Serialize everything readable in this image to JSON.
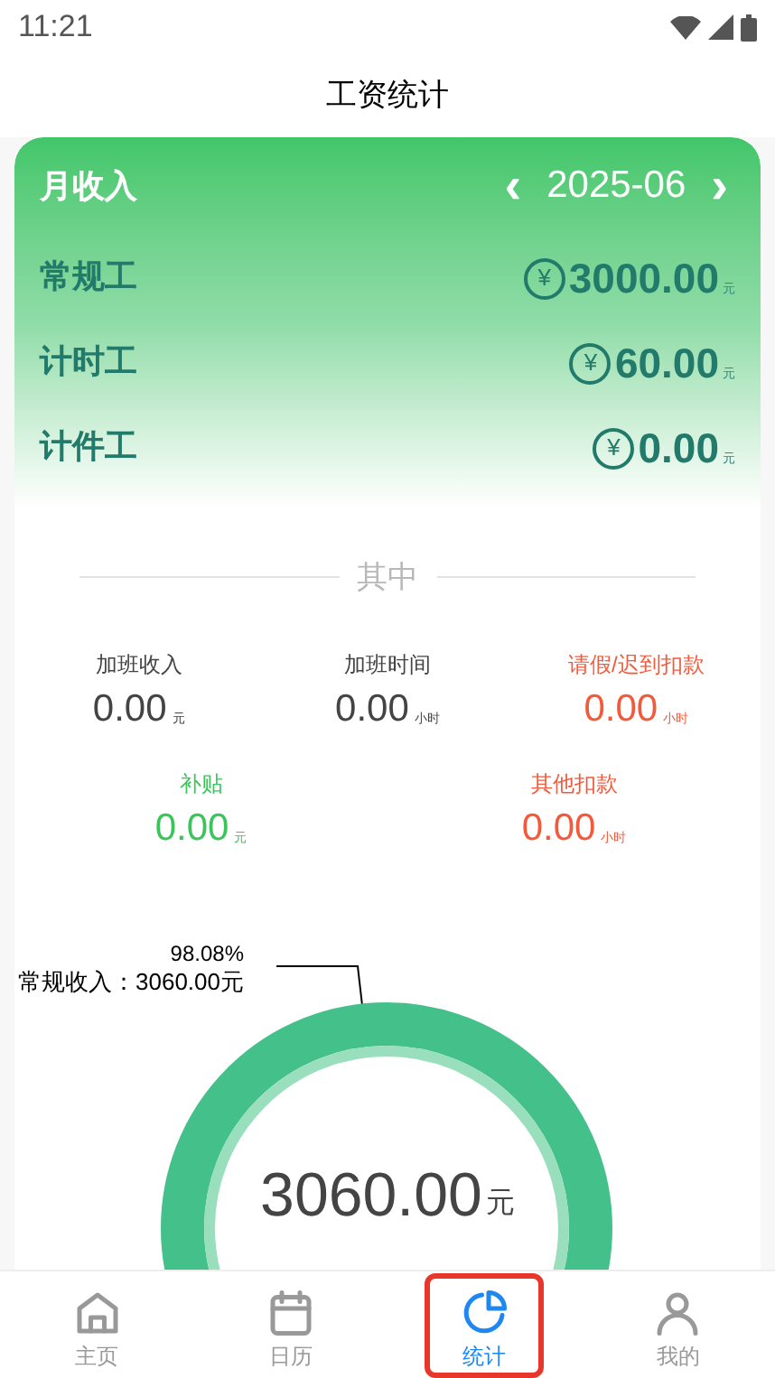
{
  "status_bar": {
    "time": "11:21"
  },
  "title": "工资统计",
  "income_card": {
    "title": "月收入",
    "prev": "‹",
    "month": "2025-06",
    "next": "›",
    "rows": [
      {
        "label": "常规工",
        "currency": "¥",
        "amount": "3000.00",
        "unit": "元"
      },
      {
        "label": "计时工",
        "currency": "¥",
        "amount": "60.00",
        "unit": "元"
      },
      {
        "label": "计件工",
        "currency": "¥",
        "amount": "0.00",
        "unit": "元"
      }
    ]
  },
  "breakdown": {
    "heading": "其中",
    "stats": [
      [
        {
          "label": "加班收入",
          "value": "0.00",
          "unit": "元",
          "color": "#444444"
        },
        {
          "label": "加班时间",
          "value": "0.00",
          "unit": "小时",
          "color": "#444444"
        },
        {
          "label": "请假/迟到扣款",
          "value": "0.00",
          "unit": "小时",
          "color": "#f25a3c"
        }
      ],
      [
        {
          "label": "补贴",
          "value": "0.00",
          "unit": "元",
          "color": "#3cc45c"
        },
        {
          "label": "其他扣款",
          "value": "0.00",
          "unit": "小时",
          "color": "#f25a3c"
        }
      ]
    ]
  },
  "donut": {
    "percent": "98.08%",
    "label": "常规收入：3060.00元",
    "total": "3060.00",
    "unit": "元"
  },
  "nav": [
    {
      "label": "主页",
      "selected": false,
      "highlighted": false
    },
    {
      "label": "日历",
      "selected": false,
      "highlighted": false
    },
    {
      "label": "统计",
      "selected": true,
      "highlighted": true
    },
    {
      "label": "我的",
      "selected": false,
      "highlighted": false
    }
  ]
}
